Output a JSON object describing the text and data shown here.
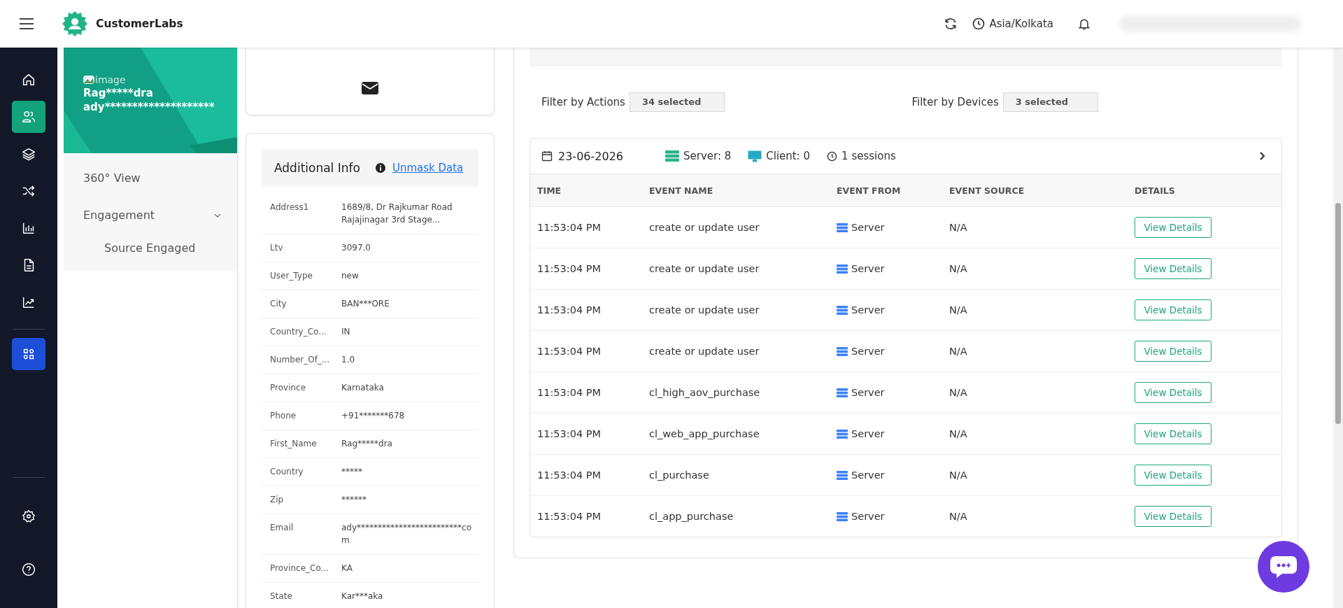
{
  "header": {
    "brand": "CustomerLabs",
    "timezone": "Asia/Kolkata"
  },
  "nav": [
    {
      "kind": "home"
    },
    {
      "kind": "users",
      "color": "#12a37b"
    },
    {
      "kind": "layers"
    },
    {
      "kind": "shuffle"
    },
    {
      "kind": "bar-chart"
    },
    {
      "kind": "document"
    },
    {
      "kind": "trend"
    },
    {
      "kind": "apps",
      "color": "#1d4ed8"
    }
  ],
  "nav_bottom": [
    {
      "kind": "settings"
    },
    {
      "kind": "help"
    }
  ],
  "profile": {
    "image_alt": "image",
    "name": "Rag*****dra",
    "email": "ady********************"
  },
  "profile_menu": [
    {
      "label": "360° View"
    },
    {
      "label": "Engagement",
      "expanded": true,
      "children": [
        {
          "label": "Source Engaged"
        }
      ]
    }
  ],
  "additional_info": {
    "title": "Additional Info",
    "link": "Unmask Data",
    "rows": [
      {
        "label": "Address1",
        "value": "1689/8, Dr Rajkumar Road Rajajinagar 3rd Stage..."
      },
      {
        "label": "Ltv",
        "value": "3097.0"
      },
      {
        "label": "User_Type",
        "value": "new"
      },
      {
        "label": "City",
        "value": "BAN***ORE"
      },
      {
        "label": "Country_Co...",
        "value": "IN"
      },
      {
        "label": "Number_Of_...",
        "value": "1.0"
      },
      {
        "label": "Province",
        "value": "Karnataka"
      },
      {
        "label": "Phone",
        "value": "+91*******678"
      },
      {
        "label": "First_Name",
        "value": "Rag*****dra"
      },
      {
        "label": "Country",
        "value": "*****"
      },
      {
        "label": "Zip",
        "value": "******"
      },
      {
        "label": "Email",
        "value": "ady*************************com"
      },
      {
        "label": "Province_Co...",
        "value": "KA"
      },
      {
        "label": "State",
        "value": "Kar***aka"
      }
    ]
  },
  "journey": {
    "filters": [
      {
        "label": "Filter by Actions",
        "value": "34 selected"
      },
      {
        "label": "Filter by Devices",
        "value": "3 selected"
      }
    ],
    "session": {
      "date": "23-06-2026",
      "server": "Server: 8",
      "client": "Client: 0",
      "sessions": "1 sessions"
    },
    "columns": [
      "TIME",
      "EVENT NAME",
      "EVENT FROM",
      "EVENT SOURCE",
      "DETAILS"
    ],
    "rows": [
      {
        "time": "11:53:04 PM",
        "event": "create or update user",
        "from": "Server",
        "source": "N/A",
        "action": "View Details"
      },
      {
        "time": "11:53:04 PM",
        "event": "create or update user",
        "from": "Server",
        "source": "N/A",
        "action": "View Details"
      },
      {
        "time": "11:53:04 PM",
        "event": "create or update user",
        "from": "Server",
        "source": "N/A",
        "action": "View Details"
      },
      {
        "time": "11:53:04 PM",
        "event": "create or update user",
        "from": "Server",
        "source": "N/A",
        "action": "View Details"
      },
      {
        "time": "11:53:04 PM",
        "event": "cl_high_aov_purchase",
        "from": "Server",
        "source": "N/A",
        "action": "View Details"
      },
      {
        "time": "11:53:04 PM",
        "event": "cl_web_app_purchase",
        "from": "Server",
        "source": "N/A",
        "action": "View Details"
      },
      {
        "time": "11:53:04 PM",
        "event": "cl_purchase",
        "from": "Server",
        "source": "N/A",
        "action": "View Details"
      },
      {
        "time": "11:53:04 PM",
        "event": "cl_app_purchase",
        "from": "Server",
        "source": "N/A",
        "action": "View Details"
      }
    ]
  }
}
